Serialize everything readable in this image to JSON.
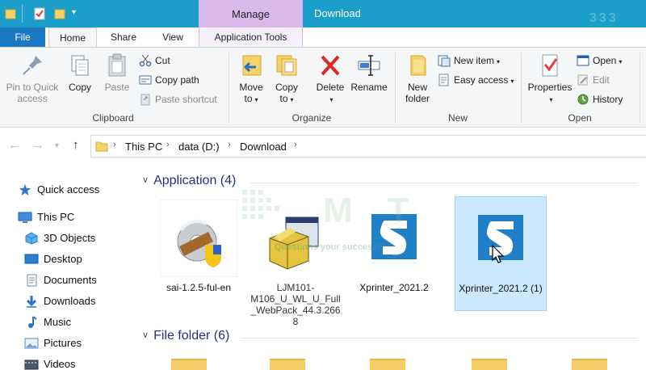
{
  "titlebar": {
    "manage_label": "Manage",
    "window_title": "Download",
    "watermark_digits": "333"
  },
  "tabs": {
    "file": "File",
    "home": "Home",
    "share": "Share",
    "view": "View",
    "application_tools": "Application Tools"
  },
  "ribbon": {
    "clipboard": {
      "label": "Clipboard",
      "pin_line1": "Pin to Quick",
      "pin_line2": "access",
      "copy": "Copy",
      "paste": "Paste",
      "cut": "Cut",
      "copy_path": "Copy path",
      "paste_shortcut": "Paste shortcut"
    },
    "organize": {
      "label": "Organize",
      "move_line1": "Move",
      "move_line2": "to",
      "copy_line1": "Copy",
      "copy_line2": "to",
      "delete": "Delete",
      "rename": "Rename"
    },
    "new": {
      "label": "New",
      "new_folder_line1": "New",
      "new_folder_line2": "folder",
      "new_item": "New item",
      "easy_access": "Easy access"
    },
    "open": {
      "label": "Open",
      "properties": "Properties",
      "open": "Open",
      "edit": "Edit",
      "history": "History"
    }
  },
  "address": {
    "crumbs": [
      "This PC",
      "data (D:)",
      "Download"
    ]
  },
  "sidebar": {
    "items": [
      {
        "label": "Quick access",
        "icon": "star-icon"
      },
      {
        "label": "This PC",
        "icon": "monitor-icon"
      },
      {
        "label": "3D Objects",
        "icon": "cube-icon"
      },
      {
        "label": "Desktop",
        "icon": "desktop-icon"
      },
      {
        "label": "Documents",
        "icon": "document-icon"
      },
      {
        "label": "Downloads",
        "icon": "download-arrow-icon"
      },
      {
        "label": "Music",
        "icon": "music-note-icon"
      },
      {
        "label": "Pictures",
        "icon": "picture-icon"
      },
      {
        "label": "Videos",
        "icon": "video-icon"
      }
    ]
  },
  "main": {
    "application_group": "Application (4)",
    "file_folder_group": "File folder (6)",
    "files": [
      {
        "name": "sai-1.2.5-ful-en",
        "icon": "installer-disc-icon"
      },
      {
        "name": "LJM101-M106_U_WL_U_Full_WebPack_44.3.2668",
        "icon": "installer-box-icon"
      },
      {
        "name": "Xprinter_2021.2",
        "icon": "xprinter-app-icon"
      },
      {
        "name": "Xprinter_2021.2 (1)",
        "icon": "xprinter-app-icon"
      }
    ]
  },
  "watermark": {
    "tagline": "Questions your success!"
  },
  "colors": {
    "titlebar": "#1b9ec9",
    "manage_tab": "#d9b8ec",
    "file_tab": "#1b79c4",
    "selection": "#cce8ff",
    "group_header": "#1e3287"
  }
}
